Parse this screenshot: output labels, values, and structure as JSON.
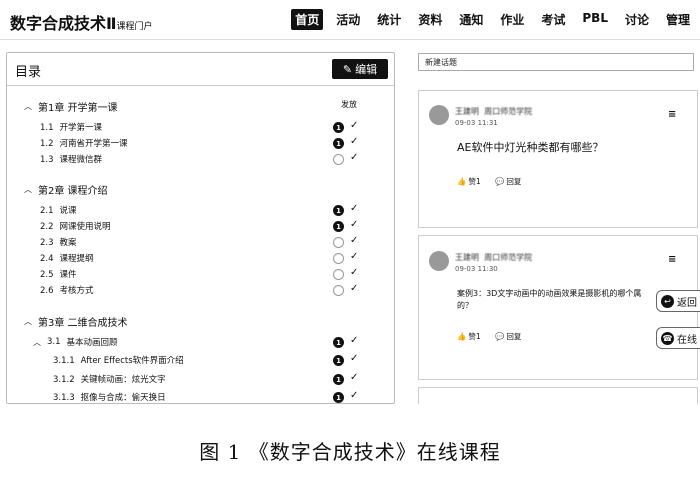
{
  "header": {
    "brand": "数字合成技术Ⅱ",
    "brand_sub": "课程门户",
    "nav": [
      "首页",
      "活动",
      "统计",
      "资料",
      "通知",
      "作业",
      "考试",
      "PBL",
      "讨论",
      "管理"
    ],
    "active_nav": "首页"
  },
  "toc": {
    "title": "目录",
    "edit_label": "编辑",
    "publish_label": "发放",
    "chapters": [
      {
        "label": "第1章 开学第一课",
        "sections": [
          {
            "num": "1.1",
            "label": "开学第一课",
            "status": "1"
          },
          {
            "num": "1.2",
            "label": "河南省开学第一课",
            "status": "1"
          },
          {
            "num": "1.3",
            "label": "课程微信群",
            "status": ""
          }
        ]
      },
      {
        "label": "第2章 课程介绍",
        "sections": [
          {
            "num": "2.1",
            "label": "说课",
            "status": "1"
          },
          {
            "num": "2.2",
            "label": "网课使用说明",
            "status": "1"
          },
          {
            "num": "2.3",
            "label": "教案",
            "status": ""
          },
          {
            "num": "2.4",
            "label": "课程提纲",
            "status": ""
          },
          {
            "num": "2.5",
            "label": "课件",
            "status": ""
          },
          {
            "num": "2.6",
            "label": "考核方式",
            "status": ""
          }
        ]
      },
      {
        "label": "第3章 二维合成技术",
        "subsection": {
          "num": "3.1",
          "label": "基本动画回顾",
          "status": "1"
        },
        "items": [
          {
            "num": "3.1.1",
            "label": "After Effects软件界面介绍",
            "status": "1"
          },
          {
            "num": "3.1.2",
            "label": "关键帧动画：炫光文字",
            "status": "1"
          },
          {
            "num": "3.1.3",
            "label": "抠像与合成：偷天换日",
            "status": "1"
          }
        ]
      }
    ]
  },
  "discussion": {
    "new_topic": "新建话题",
    "posts": [
      {
        "author": "王建明",
        "dept": "周口师范学院",
        "time": "09-03 11:31",
        "question": "AE软件中灯光种类都有哪些？",
        "likes": "赞1",
        "reply": "回复"
      },
      {
        "author": "王建明",
        "dept": "周口师范学院",
        "time": "09-03 11:30",
        "question_line1": "案例3：3D文字动画中的动画效果是摄影机的哪个属",
        "question_line2": "的？",
        "likes": "赞1",
        "reply": "回复"
      }
    ],
    "fab_back": "返回",
    "fab_online": "在线"
  },
  "caption": "图 1 《数字合成技术》在线课程"
}
